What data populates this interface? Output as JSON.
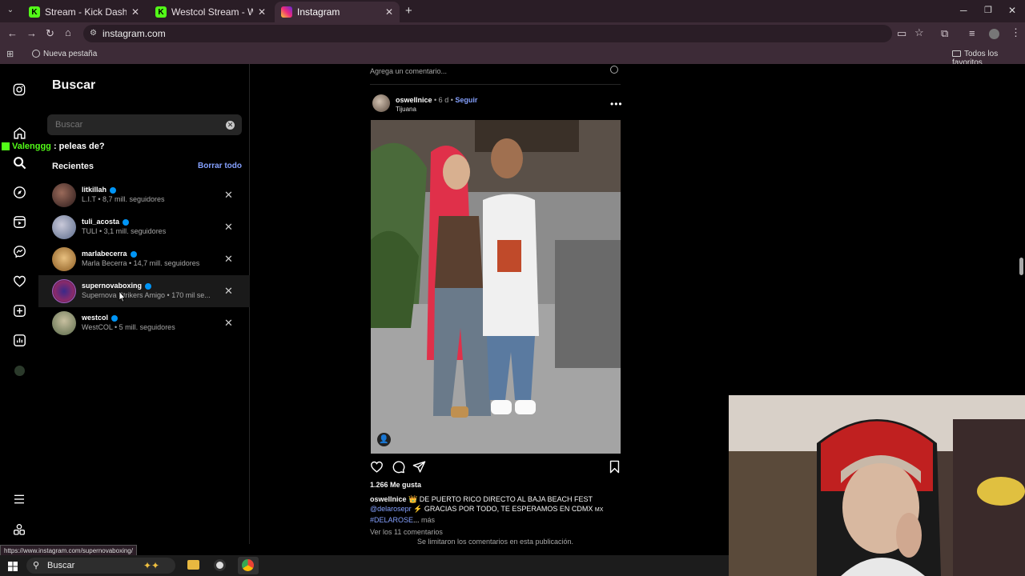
{
  "browser": {
    "tabs": [
      {
        "label": "Stream - Kick Dashboard",
        "icon": "kick-icon",
        "active": false
      },
      {
        "label": "Westcol Stream - Watch Live on",
        "icon": "kick-icon",
        "active": false
      },
      {
        "label": "Instagram",
        "icon": "instagram-icon",
        "active": true
      }
    ],
    "url": "instagram.com",
    "bookmark_newtab": "Nueva pestaña",
    "bookmark_all": "Todos los favoritos"
  },
  "search_panel": {
    "title": "Buscar",
    "placeholder": "Buscar",
    "recents_title": "Recientes",
    "clear_all": "Borrar todo",
    "items": [
      {
        "username": "litkillah",
        "subtitle": "L.I.T • 8,7 mill. seguidores"
      },
      {
        "username": "tuli_acosta",
        "subtitle": "TULI • 3,1 mill. seguidores"
      },
      {
        "username": "marlabecerra",
        "subtitle": "Marla Becerra • 14,7 mill. seguidores"
      },
      {
        "username": "supernovaboxing",
        "subtitle": "Supernova Strikers Amigo • 170 mil se..."
      },
      {
        "username": "westcol",
        "subtitle": "WestCOL • 5 mill. seguidores"
      }
    ]
  },
  "chat_overlay": {
    "user": "Valenggg",
    "message": " : peleas de?"
  },
  "post": {
    "add_comment": "Agrega un comentario...",
    "username": "oswellnice",
    "time": " • 6 d • ",
    "follow": "Seguir",
    "location": "Tijuana",
    "likes": "1.266 Me gusta",
    "caption_user": "oswellnice",
    "caption_line1": " 👑 DE PUERTO RICO DIRECTO AL BAJA BEACH FEST",
    "caption_mention": "@delarosepr",
    "caption_line2": " ⚡ GRACIAS POR TODO, TE ESPERAMOS EN CDMX ",
    "caption_flag": "MX",
    "caption_hashtag": "#DELAROSE",
    "caption_more_dots": "... ",
    "caption_more": "más",
    "view_comments": "Ver los 11 comentarios",
    "limited": "Se limitaron los comentarios en esta publicación."
  },
  "status_url": "https://www.instagram.com/supernovaboxing/",
  "taskbar": {
    "search": "Buscar"
  },
  "colors": {
    "accent_link": "#85a1ff",
    "verified": "#0095f6",
    "kick_green": "#53fc18"
  }
}
